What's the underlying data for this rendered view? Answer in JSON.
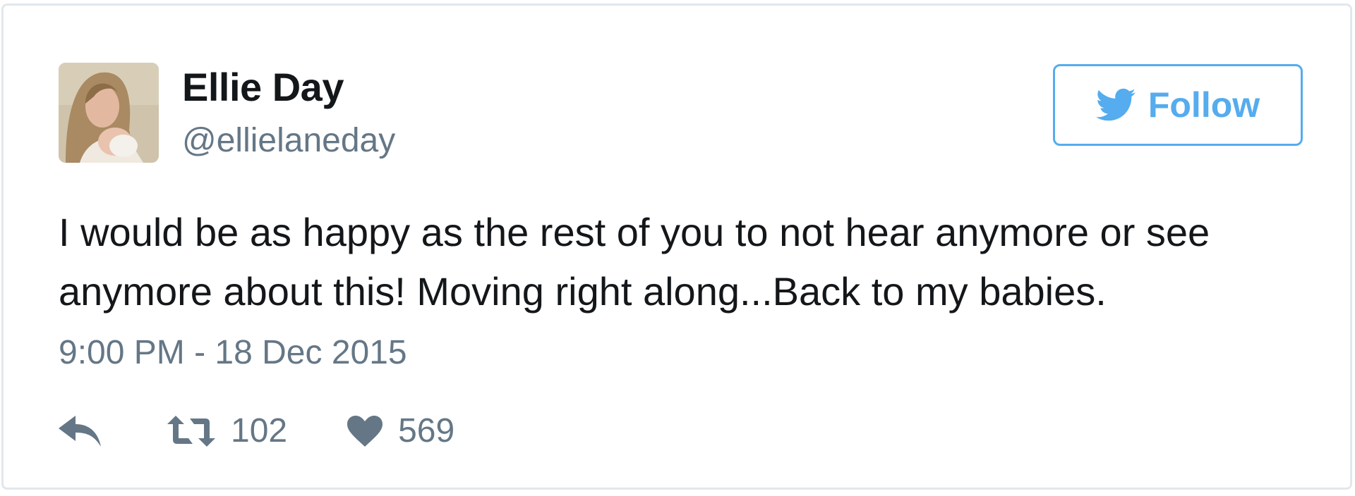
{
  "tweet": {
    "author": {
      "name": "Ellie Day",
      "handle": "@ellielaneday",
      "avatar_icon": "profile-photo"
    },
    "follow_button": {
      "label": "Follow",
      "icon": "twitter-bird-icon",
      "color": "#55acee"
    },
    "text": "I would be as happy as the rest of you to not hear anymore or see anymore about this! Moving right along...Back to my babies.",
    "timestamp": "9:00 PM - 18 Dec 2015",
    "actions": {
      "reply": {
        "icon": "reply-icon"
      },
      "retweet": {
        "icon": "retweet-icon",
        "count": "102"
      },
      "like": {
        "icon": "heart-icon",
        "count": "569"
      }
    }
  },
  "colors": {
    "text_primary": "#14171a",
    "text_secondary": "#657786",
    "accent": "#55acee",
    "border": "#e1e8ed"
  }
}
